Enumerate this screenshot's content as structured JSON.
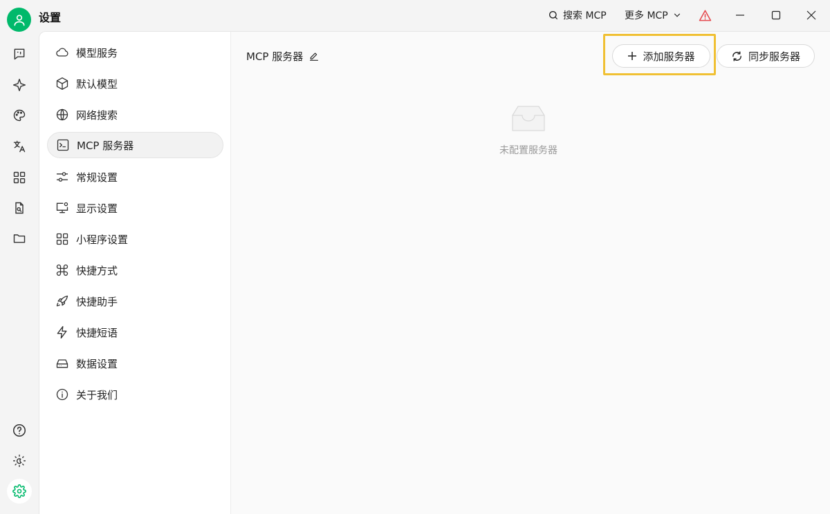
{
  "window": {
    "title": "设置",
    "search_mcp_label": "搜索 MCP",
    "more_mcp_label": "更多 MCP"
  },
  "leftbar": {
    "icons": [
      "chat-icon",
      "sparkle-icon",
      "palette-icon",
      "translate-icon",
      "apps-icon",
      "document-search-icon",
      "folder-icon",
      "help-icon",
      "theme-icon",
      "settings-icon"
    ]
  },
  "menu": {
    "items": [
      {
        "label": "模型服务",
        "icon": "cloud-icon"
      },
      {
        "label": "默认模型",
        "icon": "cube-icon"
      },
      {
        "label": "网络搜索",
        "icon": "globe-icon"
      },
      {
        "label": "MCP 服务器",
        "icon": "terminal-icon",
        "active": true
      },
      {
        "label": "常规设置",
        "icon": "sliders-icon"
      },
      {
        "label": "显示设置",
        "icon": "monitor-settings-icon"
      },
      {
        "label": "小程序设置",
        "icon": "grid-icon"
      },
      {
        "label": "快捷方式",
        "icon": "command-icon"
      },
      {
        "label": "快捷助手",
        "icon": "rocket-icon"
      },
      {
        "label": "快捷短语",
        "icon": "zap-icon"
      },
      {
        "label": "数据设置",
        "icon": "hard-drive-icon"
      },
      {
        "label": "关于我们",
        "icon": "info-icon"
      }
    ]
  },
  "content": {
    "title": "MCP 服务器",
    "add_button_label": "添加服务器",
    "sync_button_label": "同步服务器",
    "empty_text": "未配置服务器"
  },
  "colors": {
    "accent": "#00b96b",
    "highlight": "#f0c033",
    "warning": "#e5484d"
  }
}
